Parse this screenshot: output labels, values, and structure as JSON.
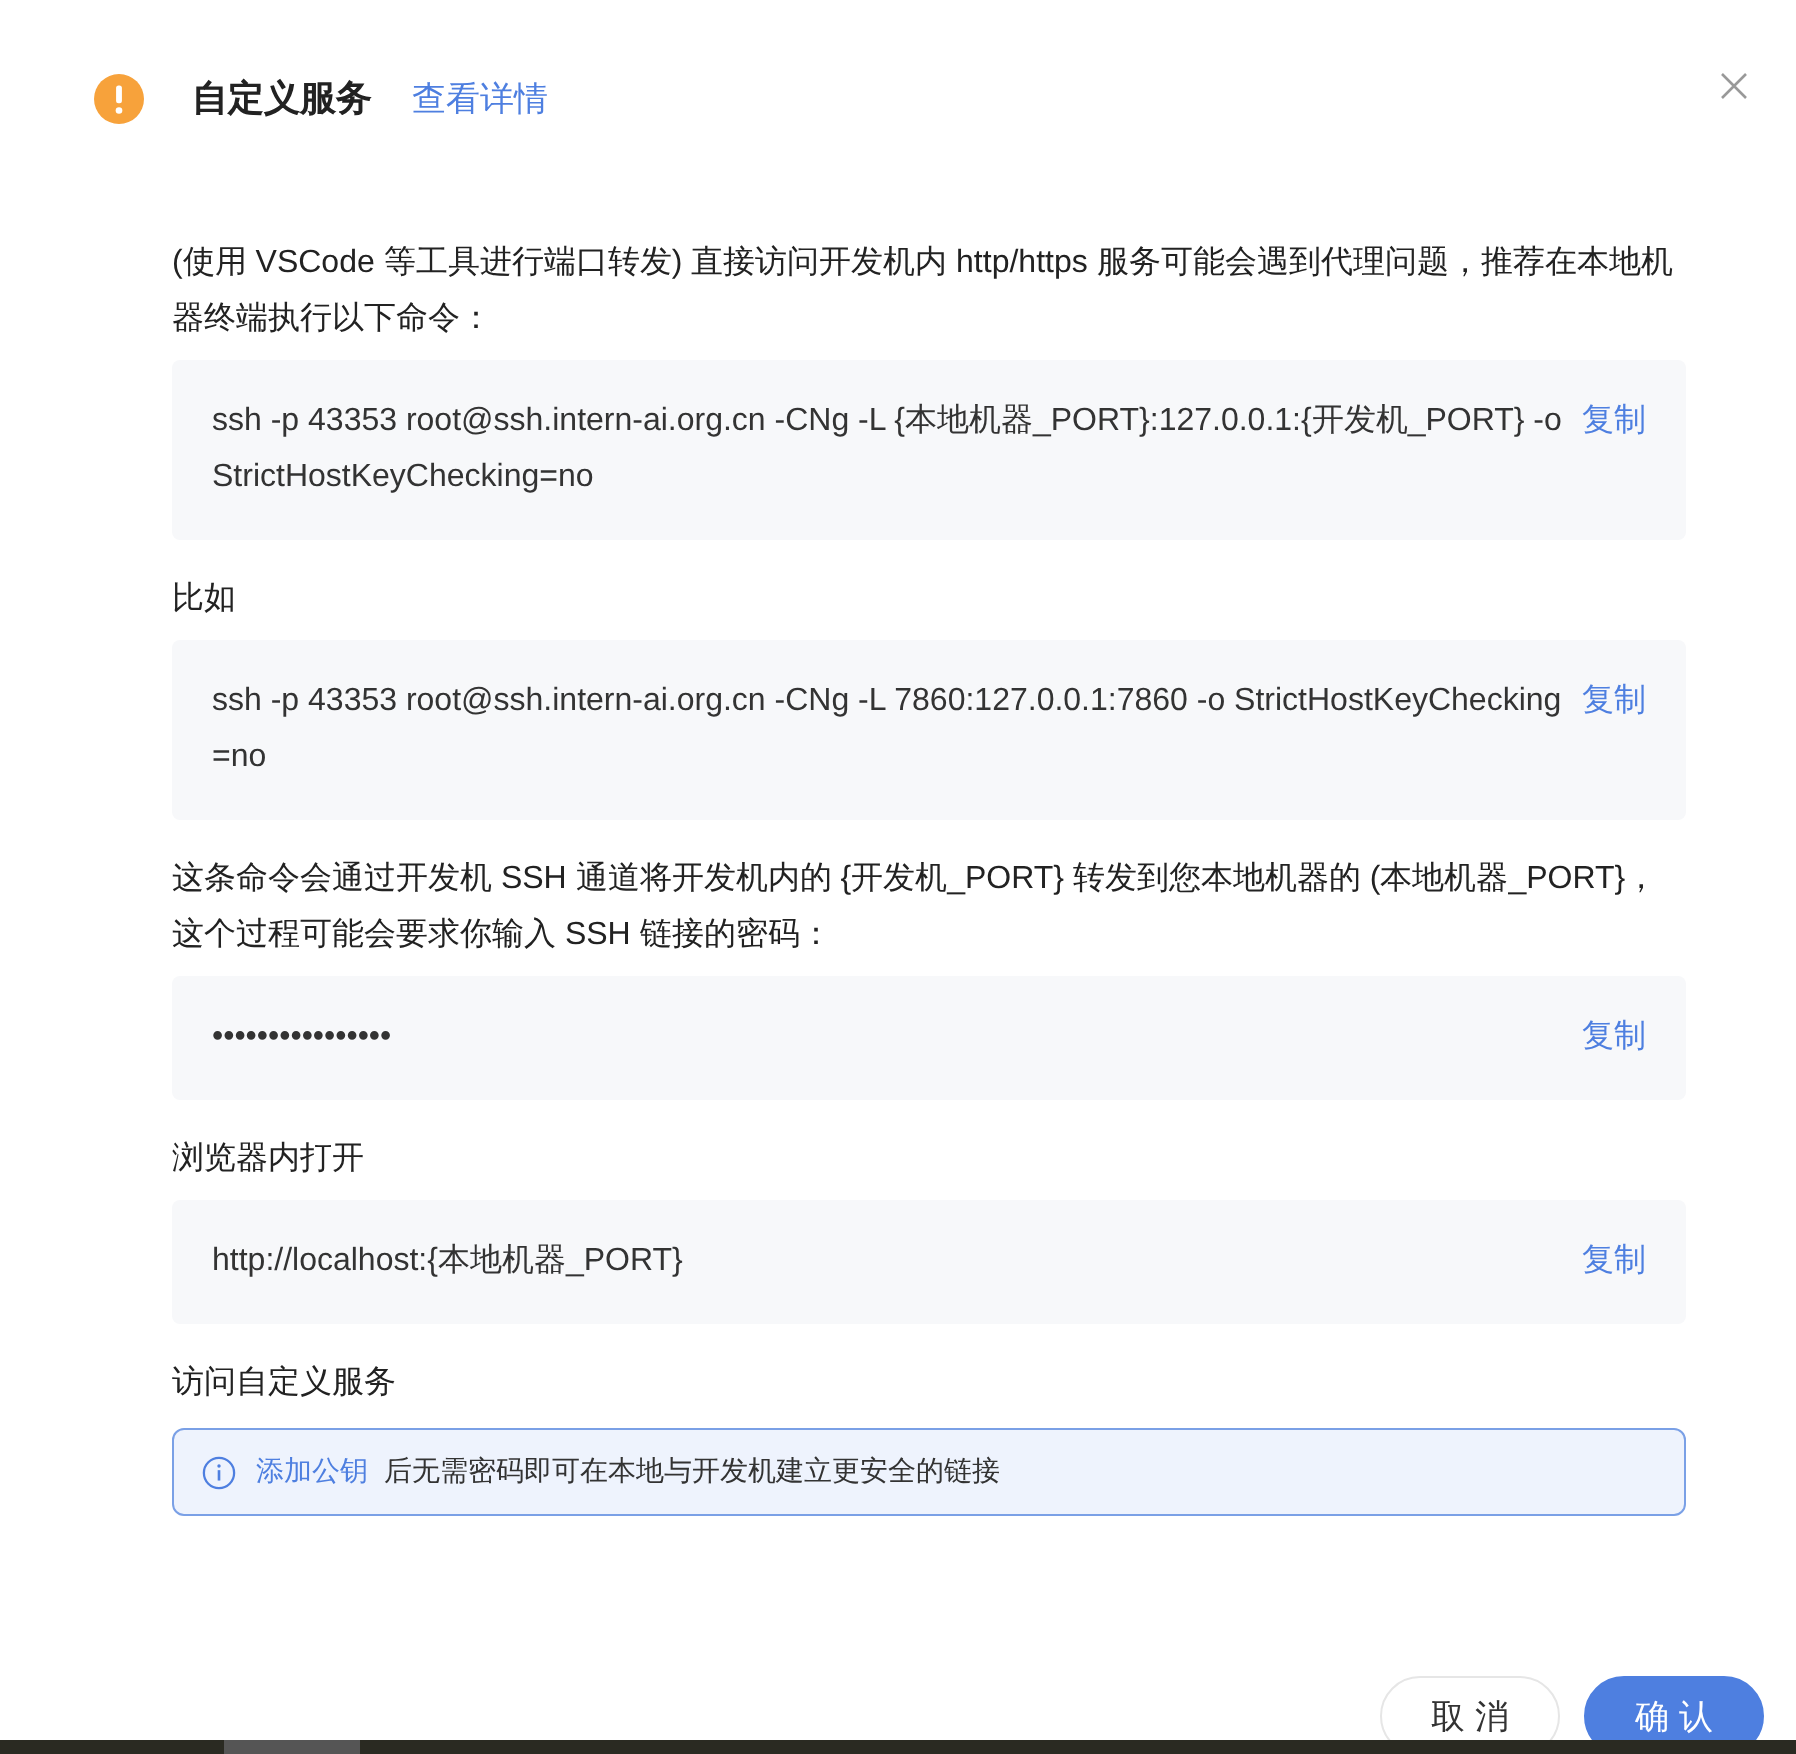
{
  "dialog": {
    "title": "自定义服务",
    "details_link": "查看详情"
  },
  "sections": [
    {
      "kind": "text",
      "text": "(使用 VSCode 等工具进行端口转发) 直接访问开发机内 http/https 服务可能会遇到代理问题，推荐在本地机器终端执行以下命令："
    },
    {
      "kind": "code",
      "text": "ssh -p 43353 root@ssh.intern-ai.org.cn -CNg -L {本地机器_PORT}:127.0.0.1:{开发机_PORT} -o StrictHostKeyChecking=no",
      "copy": "复制"
    },
    {
      "kind": "text",
      "text": "比如"
    },
    {
      "kind": "code",
      "text": "ssh -p 43353 root@ssh.intern-ai.org.cn -CNg -L 7860:127.0.0.1:7860 -o StrictHostKeyChecking=no",
      "copy": "复制"
    },
    {
      "kind": "text",
      "text": "这条命令会通过开发机 SSH 通道将开发机内的 {开发机_PORT} 转发到您本地机器的 (本地机器_PORT}，这个过程可能会要求你输入 SSH 链接的密码："
    },
    {
      "kind": "code",
      "text": "••••••••••••••••",
      "copy": "复制"
    },
    {
      "kind": "text",
      "text": "浏览器内打开"
    },
    {
      "kind": "code",
      "text": "http://localhost:{本地机器_PORT}",
      "copy": "复制"
    },
    {
      "kind": "text",
      "text": "访问自定义服务"
    },
    {
      "kind": "alert",
      "link": "添加公钥",
      "text": "后无需密码即可在本地与开发机建立更安全的链接"
    }
  ],
  "buttons": [
    {
      "label": "取 消",
      "primary": false
    },
    {
      "label": "确 认",
      "primary": true
    }
  ]
}
